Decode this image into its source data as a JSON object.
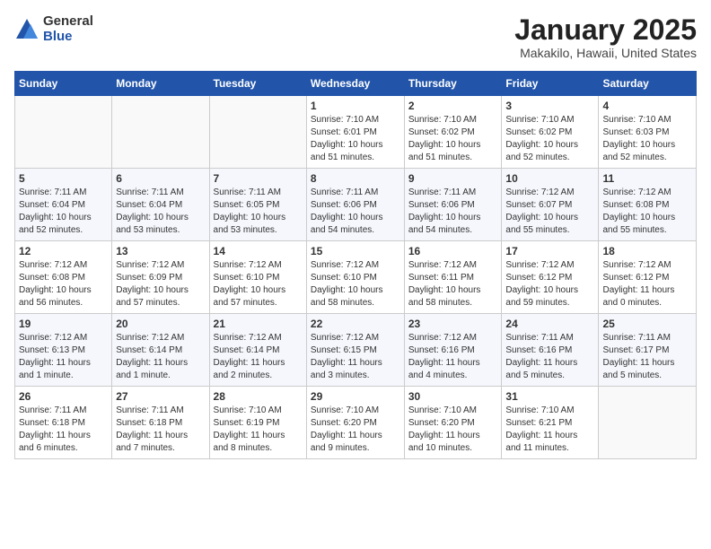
{
  "logo": {
    "general": "General",
    "blue": "Blue"
  },
  "title": "January 2025",
  "subtitle": "Makakilo, Hawaii, United States",
  "headers": [
    "Sunday",
    "Monday",
    "Tuesday",
    "Wednesday",
    "Thursday",
    "Friday",
    "Saturday"
  ],
  "weeks": [
    [
      {
        "num": "",
        "info": ""
      },
      {
        "num": "",
        "info": ""
      },
      {
        "num": "",
        "info": ""
      },
      {
        "num": "1",
        "info": "Sunrise: 7:10 AM\nSunset: 6:01 PM\nDaylight: 10 hours\nand 51 minutes."
      },
      {
        "num": "2",
        "info": "Sunrise: 7:10 AM\nSunset: 6:02 PM\nDaylight: 10 hours\nand 51 minutes."
      },
      {
        "num": "3",
        "info": "Sunrise: 7:10 AM\nSunset: 6:02 PM\nDaylight: 10 hours\nand 52 minutes."
      },
      {
        "num": "4",
        "info": "Sunrise: 7:10 AM\nSunset: 6:03 PM\nDaylight: 10 hours\nand 52 minutes."
      }
    ],
    [
      {
        "num": "5",
        "info": "Sunrise: 7:11 AM\nSunset: 6:04 PM\nDaylight: 10 hours\nand 52 minutes."
      },
      {
        "num": "6",
        "info": "Sunrise: 7:11 AM\nSunset: 6:04 PM\nDaylight: 10 hours\nand 53 minutes."
      },
      {
        "num": "7",
        "info": "Sunrise: 7:11 AM\nSunset: 6:05 PM\nDaylight: 10 hours\nand 53 minutes."
      },
      {
        "num": "8",
        "info": "Sunrise: 7:11 AM\nSunset: 6:06 PM\nDaylight: 10 hours\nand 54 minutes."
      },
      {
        "num": "9",
        "info": "Sunrise: 7:11 AM\nSunset: 6:06 PM\nDaylight: 10 hours\nand 54 minutes."
      },
      {
        "num": "10",
        "info": "Sunrise: 7:12 AM\nSunset: 6:07 PM\nDaylight: 10 hours\nand 55 minutes."
      },
      {
        "num": "11",
        "info": "Sunrise: 7:12 AM\nSunset: 6:08 PM\nDaylight: 10 hours\nand 55 minutes."
      }
    ],
    [
      {
        "num": "12",
        "info": "Sunrise: 7:12 AM\nSunset: 6:08 PM\nDaylight: 10 hours\nand 56 minutes."
      },
      {
        "num": "13",
        "info": "Sunrise: 7:12 AM\nSunset: 6:09 PM\nDaylight: 10 hours\nand 57 minutes."
      },
      {
        "num": "14",
        "info": "Sunrise: 7:12 AM\nSunset: 6:10 PM\nDaylight: 10 hours\nand 57 minutes."
      },
      {
        "num": "15",
        "info": "Sunrise: 7:12 AM\nSunset: 6:10 PM\nDaylight: 10 hours\nand 58 minutes."
      },
      {
        "num": "16",
        "info": "Sunrise: 7:12 AM\nSunset: 6:11 PM\nDaylight: 10 hours\nand 58 minutes."
      },
      {
        "num": "17",
        "info": "Sunrise: 7:12 AM\nSunset: 6:12 PM\nDaylight: 10 hours\nand 59 minutes."
      },
      {
        "num": "18",
        "info": "Sunrise: 7:12 AM\nSunset: 6:12 PM\nDaylight: 11 hours\nand 0 minutes."
      }
    ],
    [
      {
        "num": "19",
        "info": "Sunrise: 7:12 AM\nSunset: 6:13 PM\nDaylight: 11 hours\nand 1 minute."
      },
      {
        "num": "20",
        "info": "Sunrise: 7:12 AM\nSunset: 6:14 PM\nDaylight: 11 hours\nand 1 minute."
      },
      {
        "num": "21",
        "info": "Sunrise: 7:12 AM\nSunset: 6:14 PM\nDaylight: 11 hours\nand 2 minutes."
      },
      {
        "num": "22",
        "info": "Sunrise: 7:12 AM\nSunset: 6:15 PM\nDaylight: 11 hours\nand 3 minutes."
      },
      {
        "num": "23",
        "info": "Sunrise: 7:12 AM\nSunset: 6:16 PM\nDaylight: 11 hours\nand 4 minutes."
      },
      {
        "num": "24",
        "info": "Sunrise: 7:11 AM\nSunset: 6:16 PM\nDaylight: 11 hours\nand 5 minutes."
      },
      {
        "num": "25",
        "info": "Sunrise: 7:11 AM\nSunset: 6:17 PM\nDaylight: 11 hours\nand 5 minutes."
      }
    ],
    [
      {
        "num": "26",
        "info": "Sunrise: 7:11 AM\nSunset: 6:18 PM\nDaylight: 11 hours\nand 6 minutes."
      },
      {
        "num": "27",
        "info": "Sunrise: 7:11 AM\nSunset: 6:18 PM\nDaylight: 11 hours\nand 7 minutes."
      },
      {
        "num": "28",
        "info": "Sunrise: 7:10 AM\nSunset: 6:19 PM\nDaylight: 11 hours\nand 8 minutes."
      },
      {
        "num": "29",
        "info": "Sunrise: 7:10 AM\nSunset: 6:20 PM\nDaylight: 11 hours\nand 9 minutes."
      },
      {
        "num": "30",
        "info": "Sunrise: 7:10 AM\nSunset: 6:20 PM\nDaylight: 11 hours\nand 10 minutes."
      },
      {
        "num": "31",
        "info": "Sunrise: 7:10 AM\nSunset: 6:21 PM\nDaylight: 11 hours\nand 11 minutes."
      },
      {
        "num": "",
        "info": ""
      }
    ]
  ]
}
